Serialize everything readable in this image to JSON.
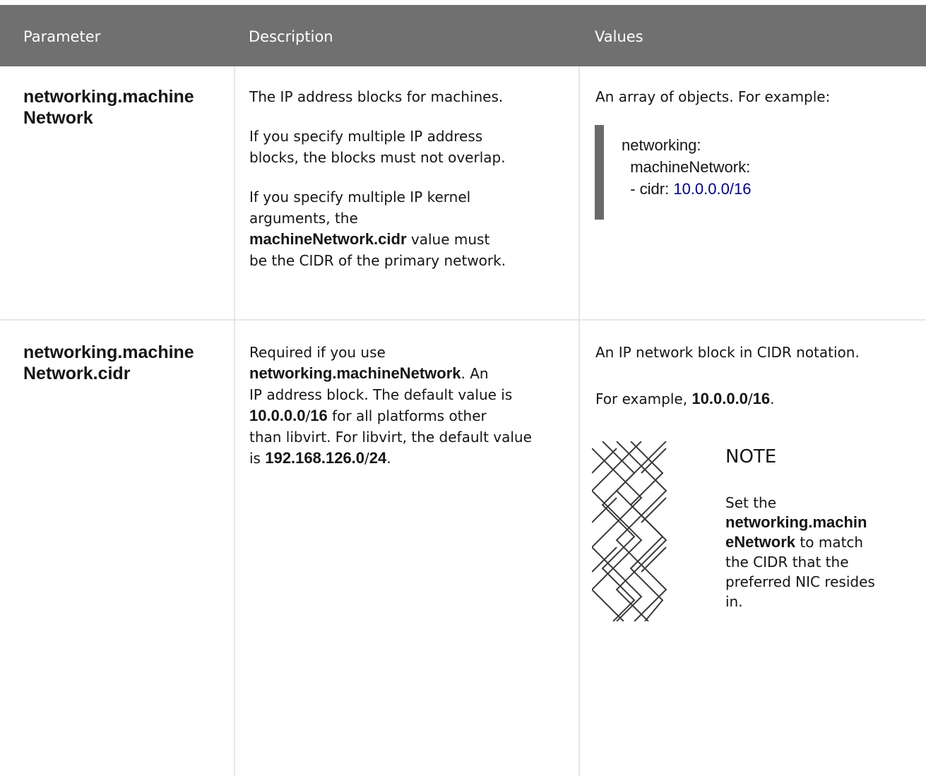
{
  "table": {
    "headers": [
      "Parameter",
      "Description",
      "Values"
    ],
    "rows": [
      {
        "parameter": [
          "networking.machine",
          "Network"
        ],
        "description": {
          "p1": "The IP address blocks for machines.",
          "p2_lines": [
            "If you specify multiple IP address",
            "blocks, the blocks must not overlap."
          ],
          "p3_lines": [
            "If you specify multiple IP kernel",
            "arguments, the"
          ],
          "p3_bold": "machineNetwork.cidr",
          "p3_tail": " value must",
          "p3_last": "be the CIDR of the primary network."
        },
        "values": {
          "intro": "An array of objects. For example:",
          "code_line1": "networking:",
          "code_line2": "  machineNetwork:",
          "code_line3_key": "  - cidr: ",
          "code_line3_value": "10.0.0.0/16"
        }
      },
      {
        "parameter": [
          "networking.machine",
          "Network.cidr"
        ],
        "description": {
          "line1": "Required if you use",
          "bold1": "networking.machineNetwork",
          "after_bold1": ". An",
          "line3": "IP address block. The default value is",
          "bold2": "10.0.0.0",
          "slash2": "/",
          "bold2b": "16",
          "after_bold2": " for all platforms other",
          "line5": "than libvirt. For libvirt, the default value",
          "prefix3": "is ",
          "bold3": "192.168.126.0",
          "slash3": "/",
          "bold3b": "24",
          "after_bold3": "."
        },
        "values": {
          "intro": "An IP network block in CIDR notation.",
          "example_prefix": "For example, ",
          "example_bold": "10.0.0.0",
          "example_slash": "/",
          "example_bold2": "16",
          "example_suffix": ".",
          "note": {
            "icon": "note-pattern-icon",
            "title": "NOTE",
            "line1": "Set the",
            "bold_line1": "networking.machin",
            "bold_line2": "eNetwork",
            "after_bold": " to match",
            "line4": "the CIDR that the",
            "line5": "preferred NIC resides",
            "line6": "in."
          }
        }
      }
    ]
  },
  "colors": {
    "header_bg": "#707070",
    "header_text": "#ffffff",
    "border": "#e6e6e6",
    "code_bar": "#6a6a6a",
    "code_number": "#000080"
  }
}
